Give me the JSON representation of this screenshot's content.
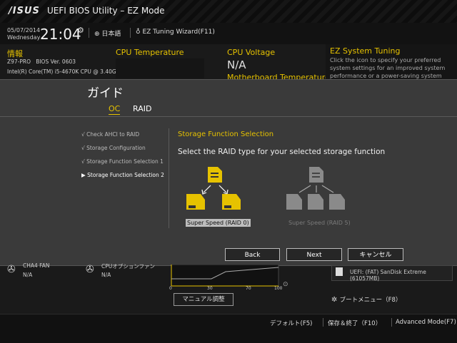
{
  "header": {
    "logo": "/ISUS",
    "app_title": "UEFI BIOS Utility – EZ Mode",
    "date": "05/07/2014",
    "day": "Wednesday",
    "time": "21:04",
    "language": "日本語",
    "ez_tuning": "EZ Tuning Wizard(F11)"
  },
  "info": {
    "title": "情報",
    "board": "Z97-PRO",
    "bios": "BIOS Ver. 0603",
    "cpu": "Intel(R) Core(TM) i5-4670K CPU @ 3.40GHz"
  },
  "cpu_temp": {
    "title": "CPU Temperature"
  },
  "cpu_voltage": {
    "title": "CPU Voltage",
    "value": "N/A",
    "mb_temp_title": "Motherboard Temperature"
  },
  "ez_tuning": {
    "title": "EZ System Tuning",
    "text": "Click the icon to specify your preferred system settings for an improved system performance or a power-saving system environment"
  },
  "guide": {
    "title": "ガイド",
    "tabs": [
      "OC",
      "RAID"
    ],
    "steps": [
      {
        "label": "Check AHCI to RAID",
        "mark": "√"
      },
      {
        "label": "Storage Configuration",
        "mark": "√"
      },
      {
        "label": "Storage Function Selection 1",
        "mark": "√"
      },
      {
        "label": "Storage Function Selection 2",
        "mark": "▶"
      }
    ],
    "section_title": "Storage Function Selection",
    "subtitle": "Select the RAID type for your selected storage function",
    "option_raid0": "Super Speed (RAID 0)",
    "option_raid5": "Super Speed (RAID 5)",
    "buttons": {
      "back": "Back",
      "next": "Next",
      "cancel": "キャンセル"
    }
  },
  "fans": {
    "cha4": {
      "name": "CHA4 FAN",
      "value": "N/A"
    },
    "cpu_opt": {
      "name": "CPUオプションファン",
      "value": "N/A"
    }
  },
  "fan_graph": {
    "ticks": [
      "0",
      "30",
      "70",
      "100"
    ],
    "manual_button": "マニュアル調整"
  },
  "boot": {
    "device": "UEFI: (FAT) SanDisk Extreme (61057MB)",
    "menu": "ブートメニュー（F8）"
  },
  "footer": {
    "default": "デフォルト(F5)",
    "save_exit": "保存＆終了（F10）",
    "advanced": "Advanced Mode(F7)"
  },
  "colors": {
    "accent": "#e6c200",
    "background": "#1a1a1a",
    "overlay": "#3a3a3a"
  }
}
